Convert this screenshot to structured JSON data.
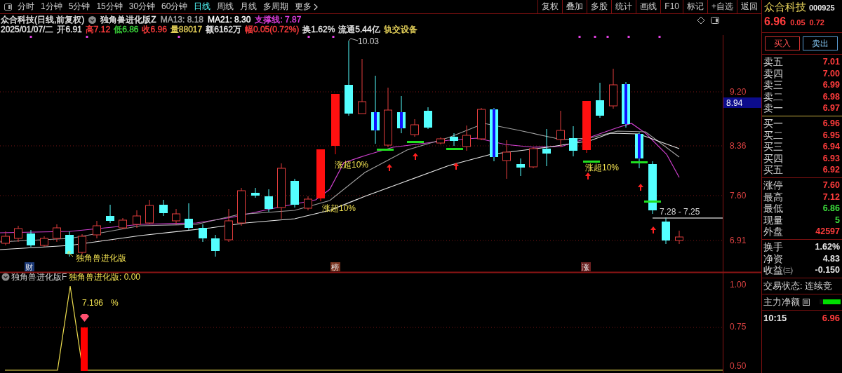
{
  "toolbar": {
    "periods": [
      {
        "label": "分时",
        "selected": false
      },
      {
        "label": "1分钟",
        "selected": false
      },
      {
        "label": "5分钟",
        "selected": false
      },
      {
        "label": "15分钟",
        "selected": false
      },
      {
        "label": "30分钟",
        "selected": false
      },
      {
        "label": "60分钟",
        "selected": false
      },
      {
        "label": "日线",
        "selected": true
      },
      {
        "label": "周线",
        "selected": false
      },
      {
        "label": "月线",
        "selected": false
      },
      {
        "label": "多周期",
        "selected": false
      }
    ],
    "more": "更多",
    "actions": [
      "复权",
      "叠加",
      "多股",
      "统计",
      "画线",
      "F10",
      "标记",
      "+自选",
      "返回"
    ]
  },
  "quote_header": {
    "title": "众合科技(日线,前复权)",
    "indicator": "独角兽进化版Z",
    "lines": [
      {
        "text": "MA13: 8.18",
        "color": "#a8a8a8"
      },
      {
        "text": "MA21: 8.30",
        "color": "#ffffff"
      },
      {
        "text": "支撑线: 7.87",
        "color": "#e040e0"
      }
    ]
  },
  "daily_stats": [
    {
      "text": "2025/01/07/二",
      "color": "#e6e6e6"
    },
    {
      "text": "开6.91",
      "color": "#e6e6e6"
    },
    {
      "text": "高7.12",
      "color": "#ff3c3c"
    },
    {
      "text": "低6.86",
      "color": "#3cdc3c"
    },
    {
      "text": "收6.96",
      "color": "#ff3c3c"
    },
    {
      "text": "量88017",
      "color": "#e6d25a"
    },
    {
      "text": "额6162万",
      "color": "#e6e6e6"
    },
    {
      "text": "幅0.05(0.72%)",
      "color": "#ff3c3c"
    },
    {
      "text": "换1.62%",
      "color": "#e6e6e6"
    },
    {
      "text": "流通5.44亿",
      "color": "#e6e6e6"
    },
    {
      "text": "轨交设备",
      "color": "#e6d25a"
    }
  ],
  "price_chart": {
    "axis_labels": [
      "9.20",
      "8.36",
      "7.60",
      "6.91"
    ],
    "current_price": "8.94",
    "high_label": "10.03",
    "signal_labels": [
      "涨超10%",
      "涨超10%",
      "涨超10%"
    ],
    "range_label": "7.28 - 7.25",
    "indicator_note": "独角兽进化版",
    "event_marks": [
      {
        "text": "财",
        "color": "#1c3a78"
      },
      {
        "text": "榜",
        "color": "#7a3420"
      },
      {
        "text": "涨",
        "color": "#6a2020"
      }
    ]
  },
  "indicator_panel": {
    "name": "独角兽进化版F",
    "value_label": "独角兽进化版: 0.00",
    "axis_labels": [
      "1.00",
      "0.75",
      "0.50"
    ],
    "peak_value": "7.196",
    "peak_unit": "%"
  },
  "side_panel": {
    "name": "众合科技",
    "code": "000925",
    "price": "6.96",
    "change": "0.05",
    "change_pct": "0.72",
    "buy_button": "买入",
    "sell_button": "卖出",
    "asks": [
      {
        "label": "卖五",
        "price": "7.01"
      },
      {
        "label": "卖四",
        "price": "7.00"
      },
      {
        "label": "卖三",
        "price": "6.99"
      },
      {
        "label": "卖二",
        "price": "6.98"
      },
      {
        "label": "卖一",
        "price": "6.97"
      }
    ],
    "bids": [
      {
        "label": "买一",
        "price": "6.96"
      },
      {
        "label": "买二",
        "price": "6.95"
      },
      {
        "label": "买三",
        "price": "6.94"
      },
      {
        "label": "买四",
        "price": "6.93"
      },
      {
        "label": "买五",
        "price": "6.92"
      }
    ],
    "stats": [
      {
        "label": "涨停",
        "value": "7.60",
        "color": "#ff3c3c"
      },
      {
        "label": "最高",
        "value": "7.12",
        "color": "#ff3c3c"
      },
      {
        "label": "最低",
        "value": "6.86",
        "color": "#3cdc3c"
      },
      {
        "label": "现量",
        "value": "5",
        "color": "#3cdc3c"
      },
      {
        "label": "外盘",
        "value": "42597",
        "color": "#ff3c3c"
      }
    ],
    "fundamentals": [
      {
        "label": "换手",
        "value": "1.62%"
      },
      {
        "label": "净资",
        "value": "4.83"
      },
      {
        "label": "收益㈢",
        "value": "-0.150"
      }
    ],
    "trade_status": "交易状态: 连续竞",
    "main_flow": {
      "label": "主力净额",
      "level": 0.85
    },
    "last_tick": {
      "time": "10:15",
      "price": "6.96"
    }
  }
}
